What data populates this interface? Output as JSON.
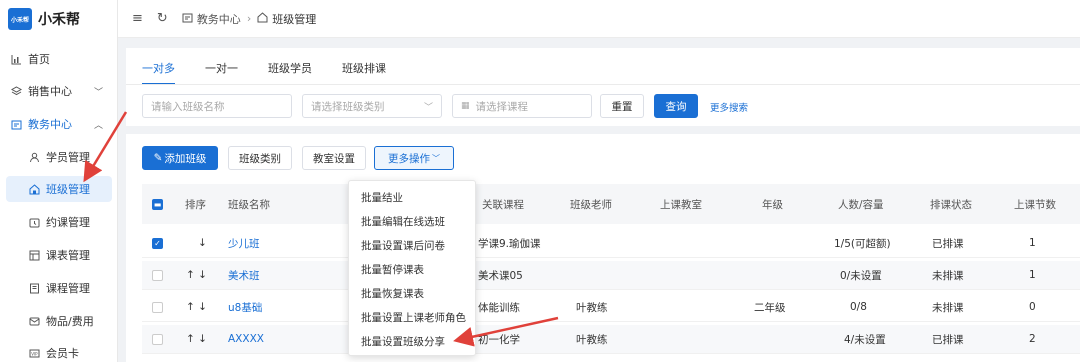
{
  "app": {
    "logo_badge": "小禾帮",
    "name": "小禾帮"
  },
  "sidebar": {
    "items": [
      {
        "label": "首页",
        "icon": "chart-icon"
      },
      {
        "label": "销售中心",
        "icon": "layers-icon"
      },
      {
        "label": "教务中心",
        "icon": "school-icon"
      },
      {
        "label": "学员管理",
        "icon": "users-icon"
      },
      {
        "label": "班级管理",
        "icon": "class-icon"
      },
      {
        "label": "约课管理",
        "icon": "calendar-icon"
      },
      {
        "label": "课表管理",
        "icon": "timetable-icon"
      },
      {
        "label": "课程管理",
        "icon": "book-icon"
      },
      {
        "label": "物品/费用",
        "icon": "mail-icon"
      },
      {
        "label": "会员卡",
        "icon": "card-icon"
      }
    ]
  },
  "breadcrumb": {
    "parent": "教务中心",
    "current": "班级管理"
  },
  "tabs": [
    "一对多",
    "一对一",
    "班级学员",
    "班级排课"
  ],
  "search": {
    "class_name_placeholder": "请输入班级名称",
    "class_type_placeholder": "请选择班级类别",
    "course_placeholder": "请选择课程",
    "reset_label": "重置",
    "query_label": "查询",
    "more_search_label": "更多搜索"
  },
  "actions": {
    "add_class": "添加班级",
    "class_type": "班级类别",
    "classroom_settings": "教室设置",
    "more_ops": "更多操作"
  },
  "more_menu": [
    "批量结业",
    "批量编辑在线选班",
    "批量设置课后问卷",
    "批量暂停课表",
    "批量恢复课表",
    "批量设置上课老师角色",
    "批量设置班级分享"
  ],
  "table": {
    "headers": [
      "排序",
      "班级名称",
      "关联课程",
      "班级老师",
      "上课教室",
      "年级",
      "人数/容量",
      "排课状态",
      "上课节数"
    ],
    "rows": [
      {
        "name": "少儿班",
        "course": "学课9.瑜伽课",
        "teacher": "",
        "room": "",
        "grade": "",
        "count": "1/5(可超额)",
        "status": "已排课",
        "lessons": "1",
        "checked": true
      },
      {
        "name": "美术班",
        "course": "美术课05",
        "teacher": "",
        "room": "",
        "grade": "",
        "count": "0/未设置",
        "status": "未排课",
        "lessons": "1",
        "checked": false
      },
      {
        "name": "u8基础",
        "course": "体能训练",
        "teacher": "叶教练",
        "room": "",
        "grade": "二年级",
        "count": "0/8",
        "status": "未排课",
        "lessons": "0",
        "checked": false
      },
      {
        "name": "AXXXX",
        "course": "初一化学",
        "teacher": "叶教练",
        "room": "",
        "grade": "",
        "count": "4/未设置",
        "status": "已排课",
        "lessons": "2",
        "checked": false
      }
    ]
  },
  "colors": {
    "primary": "#1a6fd4",
    "arrow": "#e0413a"
  }
}
